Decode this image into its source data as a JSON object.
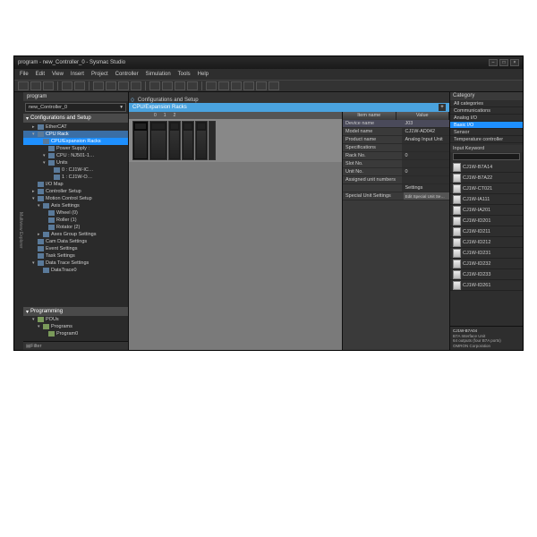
{
  "window": {
    "title": "program - new_Controller_0 - Sysmac Studio",
    "titlebar_buttons": [
      "–",
      "□",
      "×"
    ]
  },
  "menu": [
    "File",
    "Edit",
    "View",
    "Insert",
    "Project",
    "Controller",
    "Simulation",
    "Tools",
    "Help"
  ],
  "left_panel": {
    "header": "program",
    "combo": "new_Controller_0",
    "section1": "Configurations and Setup",
    "tree": [
      {
        "lvl": 1,
        "label": "EtherCAT",
        "arrow": "▸"
      },
      {
        "lvl": 1,
        "label": "CPU Rack",
        "arrow": "▾",
        "sel": true
      },
      {
        "lvl": 2,
        "label": "CPU/Expansion Racks",
        "hl": true
      },
      {
        "lvl": 3,
        "label": "Power Supply :"
      },
      {
        "lvl": 3,
        "label": "CPU : NJ501-1…",
        "arrow": "▾"
      },
      {
        "lvl": 3,
        "label": "Units",
        "arrow": "▾"
      },
      {
        "lvl": 4,
        "label": "0 : CJ1W-IC…"
      },
      {
        "lvl": 4,
        "label": "1 : CJ1W-O…"
      },
      {
        "lvl": 1,
        "label": "I/O Map"
      },
      {
        "lvl": 1,
        "label": "Controller Setup",
        "arrow": "▸"
      },
      {
        "lvl": 1,
        "label": "Motion Control Setup",
        "arrow": "▾"
      },
      {
        "lvl": 2,
        "label": "Axis Settings",
        "arrow": "▾"
      },
      {
        "lvl": 3,
        "label": "Wheel (0)"
      },
      {
        "lvl": 3,
        "label": "Roller (1)"
      },
      {
        "lvl": 3,
        "label": "Rotator (2)"
      },
      {
        "lvl": 2,
        "label": "Axes Group Settings",
        "arrow": "▸"
      },
      {
        "lvl": 1,
        "label": "Cam Data Settings"
      },
      {
        "lvl": 1,
        "label": "Event Settings"
      },
      {
        "lvl": 1,
        "label": "Task Settings"
      },
      {
        "lvl": 1,
        "label": "Data Trace Settings",
        "arrow": "▾"
      },
      {
        "lvl": 2,
        "label": "DataTrace0"
      }
    ],
    "section2": "Programming",
    "tree2": [
      {
        "lvl": 1,
        "label": "POUs",
        "arrow": "▾"
      },
      {
        "lvl": 2,
        "label": "Programs",
        "arrow": "▾"
      },
      {
        "lvl": 3,
        "label": "Program0"
      }
    ],
    "filter": "Filter"
  },
  "center": {
    "tab": "Configurations and Setup",
    "subtab": "CPU/Expansion Racks",
    "ruler": [
      "0",
      "1",
      "2"
    ]
  },
  "props": {
    "hdr_name": "Item name",
    "hdr_value": "Value",
    "rows": [
      {
        "k": "Device name",
        "v": "J03",
        "sel": true
      },
      {
        "k": "Model name",
        "v": "CJ1W-AD042"
      },
      {
        "k": "Product name",
        "v": "Analog Input Unit 4…"
      },
      {
        "k": "Specifications",
        "v": ""
      },
      {
        "k": "Rack No.",
        "v": "0"
      },
      {
        "k": "Slot No.",
        "v": ""
      },
      {
        "k": "Unit No.",
        "v": "0"
      },
      {
        "k": "Assigned unit numbers",
        "v": ""
      },
      {
        "k": "",
        "v": "Settings"
      },
      {
        "k": "Special Unit Settings",
        "v": "Edit Special Unit Se…",
        "btn": true
      }
    ]
  },
  "toolbox": {
    "cat_hdr": "Category",
    "categories": [
      {
        "label": "All categories"
      },
      {
        "label": "Communications"
      },
      {
        "label": "Analog I/O"
      },
      {
        "label": "Basic I/O",
        "sel": true
      },
      {
        "label": "Sensor"
      },
      {
        "label": "Temperature controller"
      }
    ],
    "search_lbl": "Input Keyword",
    "parts": [
      "CJ1W-B7A14",
      "CJ1W-B7A22",
      "CJ1W-CT021",
      "CJ1W-IA111",
      "CJ1W-IA201",
      "CJ1W-ID201",
      "CJ1W-ID211",
      "CJ1W-ID212",
      "CJ1W-ID231",
      "CJ1W-ID232",
      "CJ1W-ID233",
      "CJ1W-ID261"
    ],
    "desc_title": "CJ1W-B7A04",
    "desc_lines": [
      "B7A Interface Unit",
      "64 outputs (four B7A ports)",
      "OMRON Corporation"
    ]
  },
  "sidebar_vert": "Multiview Explorer"
}
